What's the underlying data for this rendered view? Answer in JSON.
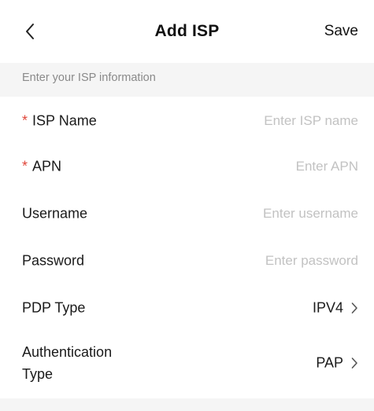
{
  "header": {
    "title": "Add ISP",
    "save_label": "Save",
    "back_icon": "chevron-left-icon"
  },
  "section_hint": "Enter your ISP information",
  "form": {
    "isp_name": {
      "required_mark": "*",
      "label": "ISP Name",
      "placeholder": "Enter ISP name",
      "value": ""
    },
    "apn": {
      "required_mark": "*",
      "label": "APN",
      "placeholder": "Enter APN",
      "value": ""
    },
    "username": {
      "label": "Username",
      "placeholder": "Enter username",
      "value": ""
    },
    "password": {
      "label": "Password",
      "placeholder": "Enter password",
      "value": ""
    },
    "pdp_type": {
      "label": "PDP Type",
      "value": "IPV4",
      "icon": "chevron-right-icon"
    },
    "auth_type": {
      "label_line1": "Authentication",
      "label_line2": "Type",
      "value": "PAP",
      "icon": "chevron-right-icon"
    }
  },
  "colors": {
    "required": "#e0463a",
    "placeholder": "#c2c2c2",
    "hint_text": "#8a8a8a",
    "page_bg": "#f5f5f5"
  }
}
